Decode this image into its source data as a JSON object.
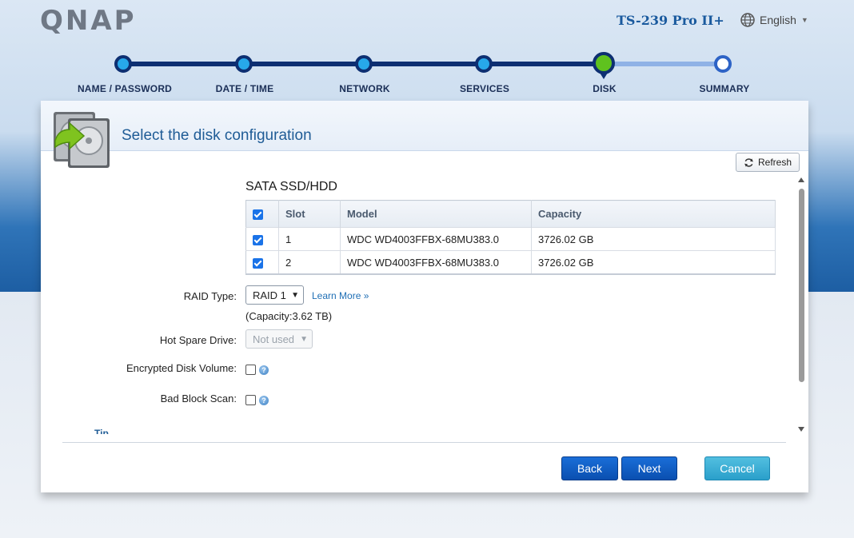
{
  "header": {
    "logo": "QNAP",
    "model": "TS-239 Pro II+",
    "language": "English"
  },
  "steps": [
    {
      "label": "NAME / PASSWORD",
      "state": "done"
    },
    {
      "label": "DATE / TIME",
      "state": "done"
    },
    {
      "label": "NETWORK",
      "state": "done"
    },
    {
      "label": "SERVICES",
      "state": "done"
    },
    {
      "label": "DISK",
      "state": "current"
    },
    {
      "label": "SUMMARY",
      "state": "todo"
    }
  ],
  "panel": {
    "title": "Select the disk configuration",
    "refresh_label": "Refresh",
    "section_title": "SATA SSD/HDD",
    "table": {
      "headers": [
        "Slot",
        "Model",
        "Capacity"
      ],
      "rows": [
        {
          "slot": "1",
          "model": "WDC WD4003FFBX-68MU383.0",
          "capacity": "3726.02 GB",
          "checked": true
        },
        {
          "slot": "2",
          "model": "WDC WD4003FFBX-68MU383.0",
          "capacity": "3726.02 GB",
          "checked": true
        }
      ]
    },
    "raid_type_label": "RAID Type:",
    "raid_type_value": "RAID 1",
    "learn_more": "Learn More »",
    "capacity_text": "(Capacity:3.62 TB)",
    "hot_spare_label": "Hot Spare Drive:",
    "hot_spare_value": "Not used",
    "encrypted_label": "Encrypted Disk Volume:",
    "bad_block_label": "Bad Block Scan:",
    "tip_label": "Tip"
  },
  "buttons": {
    "back": "Back",
    "next": "Next",
    "cancel": "Cancel"
  },
  "colors": {
    "accent": "#1f5c96",
    "step_track": "#0d2f72",
    "step_done": "#27a8ea",
    "step_current": "#5fc21e",
    "primary_button": "#0a4fb0",
    "cancel_button": "#2a9fca"
  }
}
